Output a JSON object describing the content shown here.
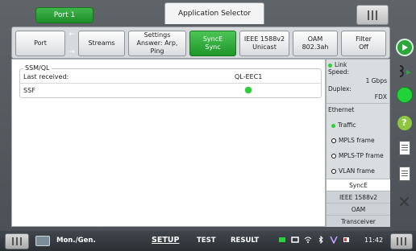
{
  "top": {
    "port_label": "Port 1",
    "app_selector_label": "Application Selector"
  },
  "tabs": [
    {
      "line1": "Port",
      "line2": ""
    },
    {
      "line1": "Streams",
      "line2": ""
    },
    {
      "line1": "Settings",
      "line2": "Answer: Arp, Ping"
    },
    {
      "line1": "SyncE",
      "line2": "Sync"
    },
    {
      "line1": "IEEE 1588v2",
      "line2": "Unicast"
    },
    {
      "line1": "OAM",
      "line2": "802.3ah"
    },
    {
      "line1": "Filter",
      "line2": "Off"
    }
  ],
  "tab_arrows": {
    "up": "←",
    "down": "→"
  },
  "ssm": {
    "title": "SSM/QL",
    "last_received_label": "Last received:",
    "last_received_value": "QL-EEC1",
    "ssf_label": "SSF"
  },
  "status_panel": {
    "link_label": "Link",
    "speed_label": "Speed:",
    "speed_value": "1 Gbps",
    "duplex_label": "Duplex:",
    "duplex_value": "FDX",
    "ethernet_label": "Ethernet",
    "traffic_label": "Traffic",
    "mpls_label": "MPLS frame",
    "mplstp_label": "MPLS-TP frame",
    "vlan_label": "VLAN frame",
    "tabs": [
      "SyncE",
      "IEEE 1588v2",
      "OAM",
      "Transceiver"
    ]
  },
  "bottom": {
    "mode_label": "Mon./Gen.",
    "setup_label": "SETUP",
    "test_label": "TEST",
    "result_label": "RESULT",
    "time": "11:42"
  },
  "colors": {
    "accent_green": "#1f952b",
    "led_green": "#29d23a"
  }
}
